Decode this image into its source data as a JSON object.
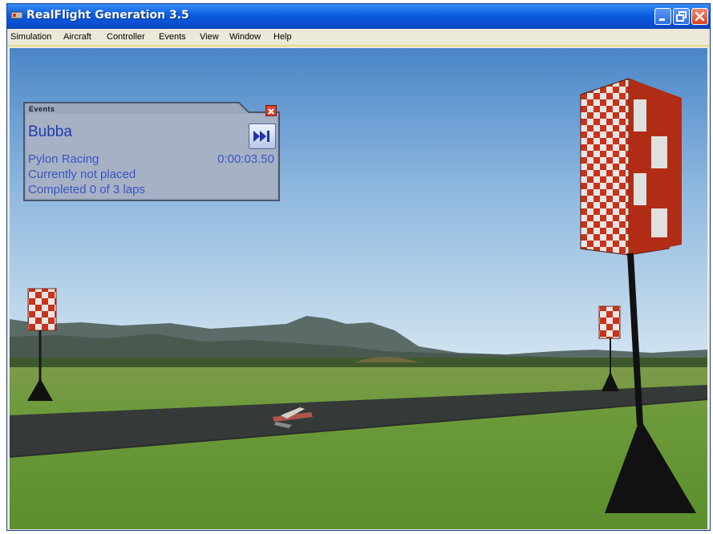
{
  "window": {
    "title": "RealFlight Generation 3.5",
    "app_icon": "realflight-app-icon",
    "buttons": [
      "minimize-icon",
      "restore-icon",
      "close-icon"
    ]
  },
  "menu": {
    "items": [
      "Simulation",
      "Aircraft",
      "Controller",
      "Events",
      "View",
      "Window",
      "Help"
    ]
  },
  "events_panel": {
    "header": "Events",
    "pilot_name": "Bubba",
    "event_type": "Pylon Racing",
    "timer": "0:00:03.50",
    "placement": "Currently not placed",
    "laps": "Completed 0 of 3 laps",
    "skip_icon": "fast-forward-icon"
  },
  "colors": {
    "title_bar": "#0a5ce0",
    "pylon_red": "#c8331a",
    "pylon_white": "#e8e8e8",
    "event_text": "#3a55c0"
  }
}
